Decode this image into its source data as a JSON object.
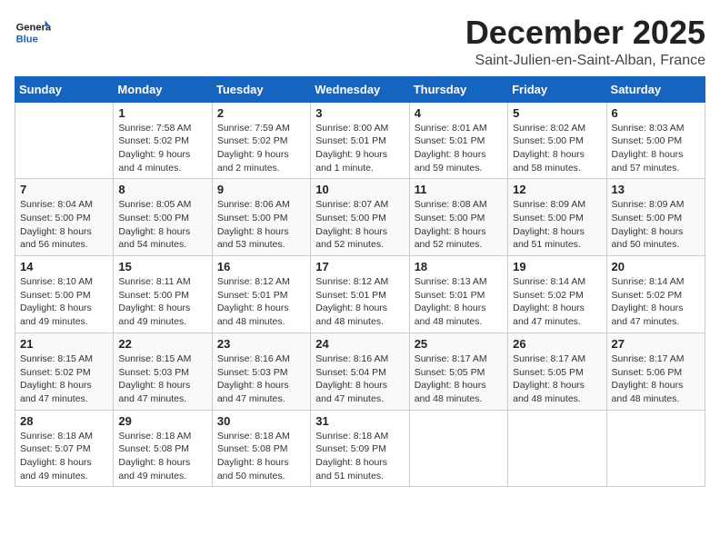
{
  "header": {
    "logo_general": "General",
    "logo_blue": "Blue",
    "month": "December 2025",
    "location": "Saint-Julien-en-Saint-Alban, France"
  },
  "days": [
    "Sunday",
    "Monday",
    "Tuesday",
    "Wednesday",
    "Thursday",
    "Friday",
    "Saturday"
  ],
  "weeks": [
    [
      {
        "date": "",
        "sunrise": "",
        "sunset": "",
        "daylight": ""
      },
      {
        "date": "1",
        "sunrise": "Sunrise: 7:58 AM",
        "sunset": "Sunset: 5:02 PM",
        "daylight": "Daylight: 9 hours and 4 minutes."
      },
      {
        "date": "2",
        "sunrise": "Sunrise: 7:59 AM",
        "sunset": "Sunset: 5:02 PM",
        "daylight": "Daylight: 9 hours and 2 minutes."
      },
      {
        "date": "3",
        "sunrise": "Sunrise: 8:00 AM",
        "sunset": "Sunset: 5:01 PM",
        "daylight": "Daylight: 9 hours and 1 minute."
      },
      {
        "date": "4",
        "sunrise": "Sunrise: 8:01 AM",
        "sunset": "Sunset: 5:01 PM",
        "daylight": "Daylight: 8 hours and 59 minutes."
      },
      {
        "date": "5",
        "sunrise": "Sunrise: 8:02 AM",
        "sunset": "Sunset: 5:00 PM",
        "daylight": "Daylight: 8 hours and 58 minutes."
      },
      {
        "date": "6",
        "sunrise": "Sunrise: 8:03 AM",
        "sunset": "Sunset: 5:00 PM",
        "daylight": "Daylight: 8 hours and 57 minutes."
      }
    ],
    [
      {
        "date": "7",
        "sunrise": "Sunrise: 8:04 AM",
        "sunset": "Sunset: 5:00 PM",
        "daylight": "Daylight: 8 hours and 56 minutes."
      },
      {
        "date": "8",
        "sunrise": "Sunrise: 8:05 AM",
        "sunset": "Sunset: 5:00 PM",
        "daylight": "Daylight: 8 hours and 54 minutes."
      },
      {
        "date": "9",
        "sunrise": "Sunrise: 8:06 AM",
        "sunset": "Sunset: 5:00 PM",
        "daylight": "Daylight: 8 hours and 53 minutes."
      },
      {
        "date": "10",
        "sunrise": "Sunrise: 8:07 AM",
        "sunset": "Sunset: 5:00 PM",
        "daylight": "Daylight: 8 hours and 52 minutes."
      },
      {
        "date": "11",
        "sunrise": "Sunrise: 8:08 AM",
        "sunset": "Sunset: 5:00 PM",
        "daylight": "Daylight: 8 hours and 52 minutes."
      },
      {
        "date": "12",
        "sunrise": "Sunrise: 8:09 AM",
        "sunset": "Sunset: 5:00 PM",
        "daylight": "Daylight: 8 hours and 51 minutes."
      },
      {
        "date": "13",
        "sunrise": "Sunrise: 8:09 AM",
        "sunset": "Sunset: 5:00 PM",
        "daylight": "Daylight: 8 hours and 50 minutes."
      }
    ],
    [
      {
        "date": "14",
        "sunrise": "Sunrise: 8:10 AM",
        "sunset": "Sunset: 5:00 PM",
        "daylight": "Daylight: 8 hours and 49 minutes."
      },
      {
        "date": "15",
        "sunrise": "Sunrise: 8:11 AM",
        "sunset": "Sunset: 5:00 PM",
        "daylight": "Daylight: 8 hours and 49 minutes."
      },
      {
        "date": "16",
        "sunrise": "Sunrise: 8:12 AM",
        "sunset": "Sunset: 5:01 PM",
        "daylight": "Daylight: 8 hours and 48 minutes."
      },
      {
        "date": "17",
        "sunrise": "Sunrise: 8:12 AM",
        "sunset": "Sunset: 5:01 PM",
        "daylight": "Daylight: 8 hours and 48 minutes."
      },
      {
        "date": "18",
        "sunrise": "Sunrise: 8:13 AM",
        "sunset": "Sunset: 5:01 PM",
        "daylight": "Daylight: 8 hours and 48 minutes."
      },
      {
        "date": "19",
        "sunrise": "Sunrise: 8:14 AM",
        "sunset": "Sunset: 5:02 PM",
        "daylight": "Daylight: 8 hours and 47 minutes."
      },
      {
        "date": "20",
        "sunrise": "Sunrise: 8:14 AM",
        "sunset": "Sunset: 5:02 PM",
        "daylight": "Daylight: 8 hours and 47 minutes."
      }
    ],
    [
      {
        "date": "21",
        "sunrise": "Sunrise: 8:15 AM",
        "sunset": "Sunset: 5:02 PM",
        "daylight": "Daylight: 8 hours and 47 minutes."
      },
      {
        "date": "22",
        "sunrise": "Sunrise: 8:15 AM",
        "sunset": "Sunset: 5:03 PM",
        "daylight": "Daylight: 8 hours and 47 minutes."
      },
      {
        "date": "23",
        "sunrise": "Sunrise: 8:16 AM",
        "sunset": "Sunset: 5:03 PM",
        "daylight": "Daylight: 8 hours and 47 minutes."
      },
      {
        "date": "24",
        "sunrise": "Sunrise: 8:16 AM",
        "sunset": "Sunset: 5:04 PM",
        "daylight": "Daylight: 8 hours and 47 minutes."
      },
      {
        "date": "25",
        "sunrise": "Sunrise: 8:17 AM",
        "sunset": "Sunset: 5:05 PM",
        "daylight": "Daylight: 8 hours and 48 minutes."
      },
      {
        "date": "26",
        "sunrise": "Sunrise: 8:17 AM",
        "sunset": "Sunset: 5:05 PM",
        "daylight": "Daylight: 8 hours and 48 minutes."
      },
      {
        "date": "27",
        "sunrise": "Sunrise: 8:17 AM",
        "sunset": "Sunset: 5:06 PM",
        "daylight": "Daylight: 8 hours and 48 minutes."
      }
    ],
    [
      {
        "date": "28",
        "sunrise": "Sunrise: 8:18 AM",
        "sunset": "Sunset: 5:07 PM",
        "daylight": "Daylight: 8 hours and 49 minutes."
      },
      {
        "date": "29",
        "sunrise": "Sunrise: 8:18 AM",
        "sunset": "Sunset: 5:08 PM",
        "daylight": "Daylight: 8 hours and 49 minutes."
      },
      {
        "date": "30",
        "sunrise": "Sunrise: 8:18 AM",
        "sunset": "Sunset: 5:08 PM",
        "daylight": "Daylight: 8 hours and 50 minutes."
      },
      {
        "date": "31",
        "sunrise": "Sunrise: 8:18 AM",
        "sunset": "Sunset: 5:09 PM",
        "daylight": "Daylight: 8 hours and 51 minutes."
      },
      {
        "date": "",
        "sunrise": "",
        "sunset": "",
        "daylight": ""
      },
      {
        "date": "",
        "sunrise": "",
        "sunset": "",
        "daylight": ""
      },
      {
        "date": "",
        "sunrise": "",
        "sunset": "",
        "daylight": ""
      }
    ]
  ]
}
